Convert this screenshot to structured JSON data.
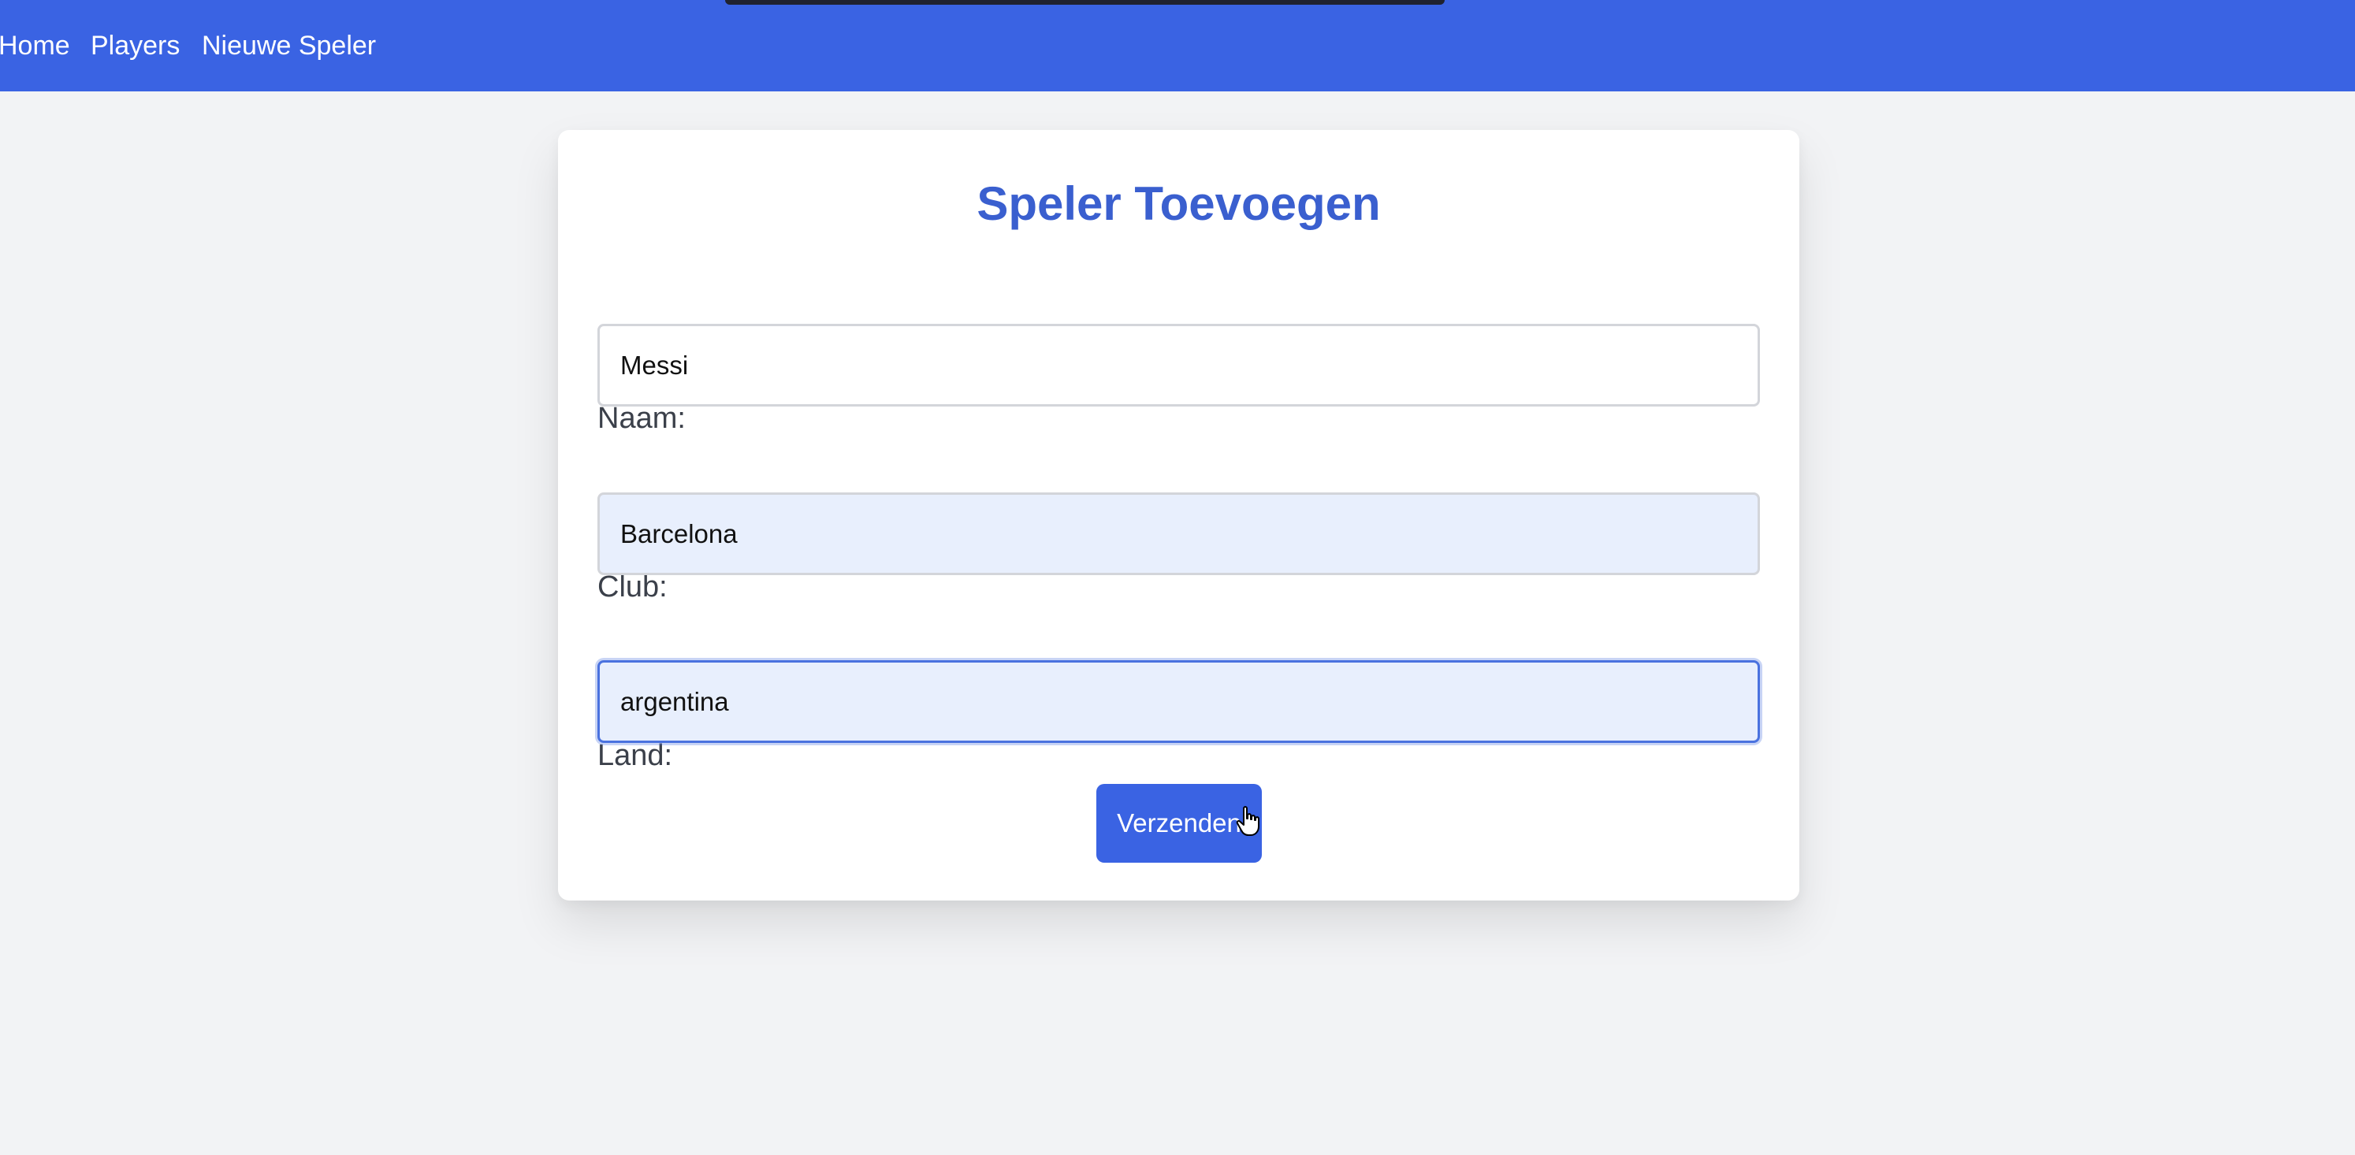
{
  "nav": {
    "items": [
      {
        "label": "Home"
      },
      {
        "label": "Players"
      },
      {
        "label": "Nieuwe Speler"
      }
    ]
  },
  "form": {
    "title": "Speler Toevoegen",
    "fields": {
      "naam": {
        "label": "Naam:",
        "value": "Messi"
      },
      "club": {
        "label": "Club:",
        "value": "Barcelona"
      },
      "land": {
        "label": "Land:",
        "value": "argentina"
      }
    },
    "submit_label": "Verzenden"
  },
  "colors": {
    "accent": "#3a63e3",
    "title": "#3a5fcf",
    "autofill_bg": "#e8effd",
    "page_bg": "#f2f3f5"
  },
  "icons": {
    "cursor": "hand-pointer-icon"
  }
}
